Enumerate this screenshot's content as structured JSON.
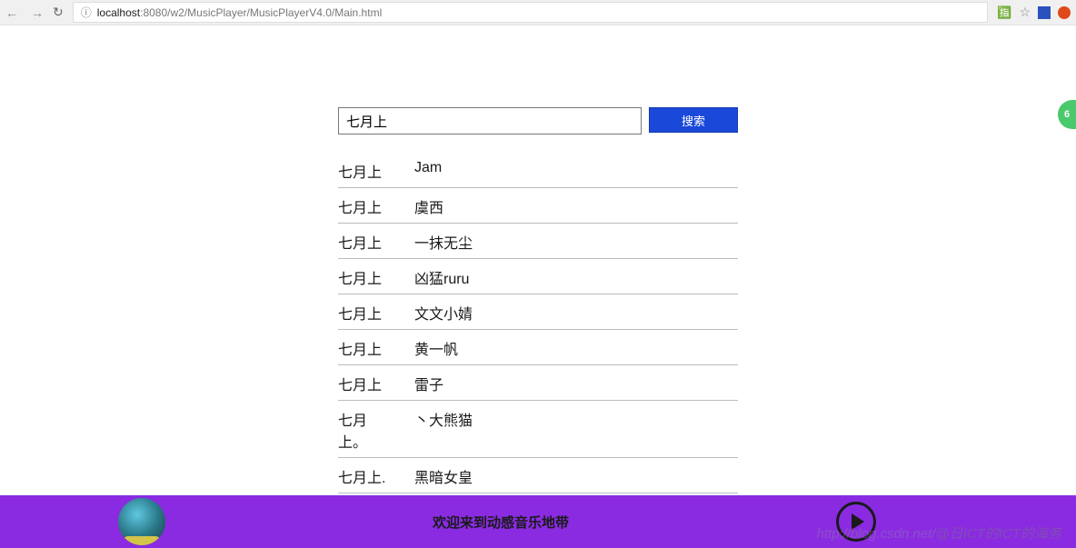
{
  "browser": {
    "url_host": "localhost",
    "url_port": ":8080",
    "url_path": "/w2/MusicPlayer/MusicPlayerV4.0/Main.html",
    "info_icon": "ⓘ"
  },
  "search": {
    "value": "七月上",
    "button_label": "搜索"
  },
  "results": [
    {
      "title": "七月上",
      "artist": "Jam"
    },
    {
      "title": "七月上",
      "artist": "虞西"
    },
    {
      "title": "七月上",
      "artist": "一抹无尘"
    },
    {
      "title": "七月上",
      "artist": "凶猛ruru"
    },
    {
      "title": "七月上",
      "artist": "文文小婧"
    },
    {
      "title": "七月上",
      "artist": "黄一帆"
    },
    {
      "title": "七月上",
      "artist": "雷子"
    },
    {
      "title": "七月上。",
      "artist": "丶大熊猫"
    },
    {
      "title": "七月上.",
      "artist": "黑暗女皇"
    }
  ],
  "badge": {
    "text": "6"
  },
  "player": {
    "welcome": "欢迎来到动感音乐地带"
  },
  "watermark": {
    "url": "http://blog.csdn.net/",
    "handle": "@日ICT的ICT的海务"
  }
}
